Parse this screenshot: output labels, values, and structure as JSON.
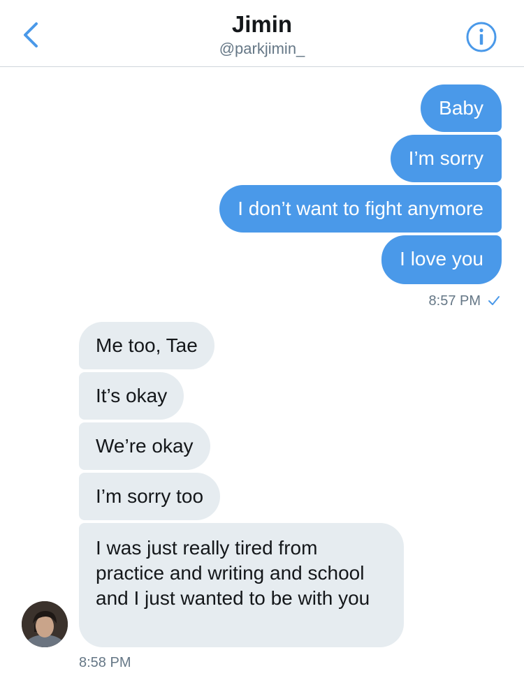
{
  "header": {
    "title": "Jimin",
    "handle": "@parkjimin_",
    "back_icon": "chevron-left-icon",
    "info_icon": "info-icon",
    "accent_color": "#4a99e9"
  },
  "conversation": {
    "outgoing": [
      {
        "text": "Baby"
      },
      {
        "text": "I’m sorry"
      },
      {
        "text": "I don’t want to fight anymore"
      },
      {
        "text": "I love you"
      }
    ],
    "outgoing_timestamp": "8:57 PM",
    "outgoing_status_icon": "checkmark-icon",
    "incoming": [
      {
        "text": "Me too, Tae"
      },
      {
        "text": "It’s okay"
      },
      {
        "text": "We’re okay"
      },
      {
        "text": "I’m sorry too"
      },
      {
        "text": "I was just really tired from practice and writing and school and I just wanted to be with you"
      }
    ],
    "incoming_timestamp": "8:58 PM",
    "outgoing_bubble_color": "#4a99e9",
    "incoming_bubble_color": "#e6ecf0"
  }
}
